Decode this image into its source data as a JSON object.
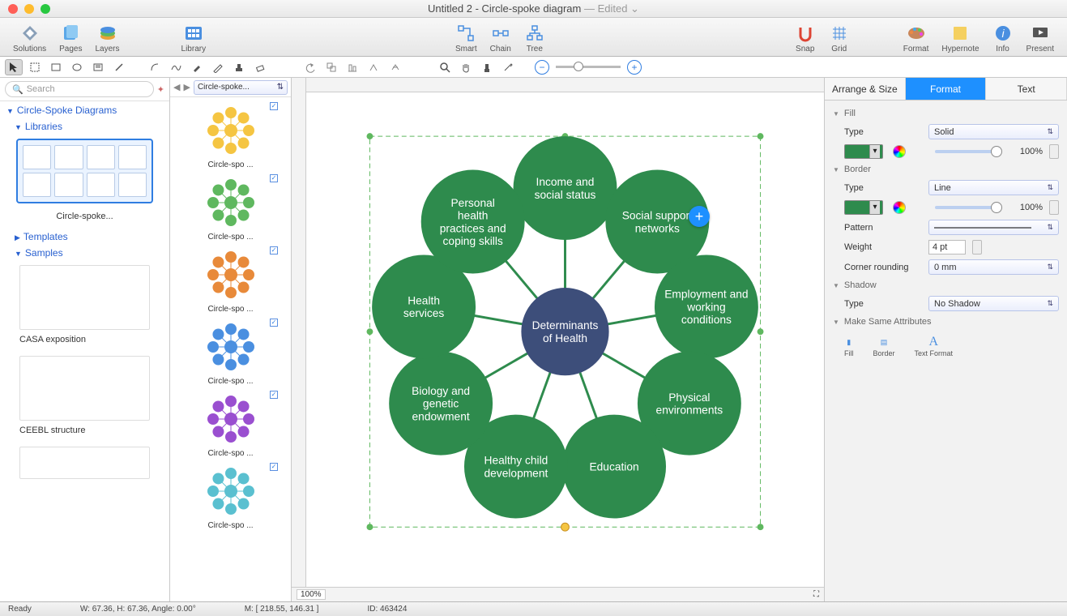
{
  "window": {
    "title_main": "Untitled 2 - Circle-spoke diagram",
    "title_suffix": " — Edited",
    "chevron": " ⌄"
  },
  "toolbar": {
    "left": [
      {
        "label": "Solutions"
      },
      {
        "label": "Pages"
      },
      {
        "label": "Layers"
      }
    ],
    "library": {
      "label": "Library"
    },
    "center": [
      {
        "label": "Smart"
      },
      {
        "label": "Chain"
      },
      {
        "label": "Tree"
      }
    ],
    "right1": [
      {
        "label": "Snap"
      },
      {
        "label": "Grid"
      }
    ],
    "right2": [
      {
        "label": "Format"
      },
      {
        "label": "Hypernote"
      },
      {
        "label": "Info"
      },
      {
        "label": "Present"
      }
    ]
  },
  "search": {
    "placeholder": "Search"
  },
  "tree": {
    "root": "Circle-Spoke Diagrams",
    "libraries": "Libraries",
    "lib_caption": "Circle-spoke...",
    "templates": "Templates",
    "samples": "Samples",
    "sample1": "CASA exposition",
    "sample2": "CEEBL structure"
  },
  "shapes": {
    "selector": "Circle-spoke...",
    "items": [
      "Circle-spo ...",
      "Circle-spo ...",
      "Circle-spo ...",
      "Circle-spo ...",
      "Circle-spo ...",
      "Circle-spo ..."
    ]
  },
  "diagram": {
    "center": "Determinants of Health",
    "spokes": [
      "Income and social status",
      "Social support networks",
      "Employment and working conditions",
      "Physical environments",
      "Education",
      "Healthy child development",
      "Biology and genetic endowment",
      "Health services",
      "Personal health practices and coping skills"
    ],
    "center_color": "#3d4e7a",
    "spoke_color": "#2e8b4d"
  },
  "format": {
    "tabs": [
      "Arrange & Size",
      "Format",
      "Text"
    ],
    "fill": {
      "hdr": "Fill",
      "type_lbl": "Type",
      "type_val": "Solid",
      "pct": "100%"
    },
    "border": {
      "hdr": "Border",
      "type_lbl": "Type",
      "type_val": "Line",
      "pct": "100%",
      "pattern_lbl": "Pattern",
      "weight_lbl": "Weight",
      "weight_val": "4 pt",
      "corner_lbl": "Corner rounding",
      "corner_val": "0 mm"
    },
    "shadow": {
      "hdr": "Shadow",
      "type_lbl": "Type",
      "type_val": "No Shadow"
    },
    "make": {
      "hdr": "Make Same Attributes",
      "b1": "Fill",
      "b2": "Border",
      "b3": "Text Format"
    }
  },
  "canvas_footer": {
    "zoom": "100%"
  },
  "status": {
    "ready": "Ready",
    "dims": "W: 67.36,   H: 67.36,   Angle: 0.00°",
    "mouse": "M: [ 218.55, 146.31 ]",
    "id": "ID: 463424"
  }
}
